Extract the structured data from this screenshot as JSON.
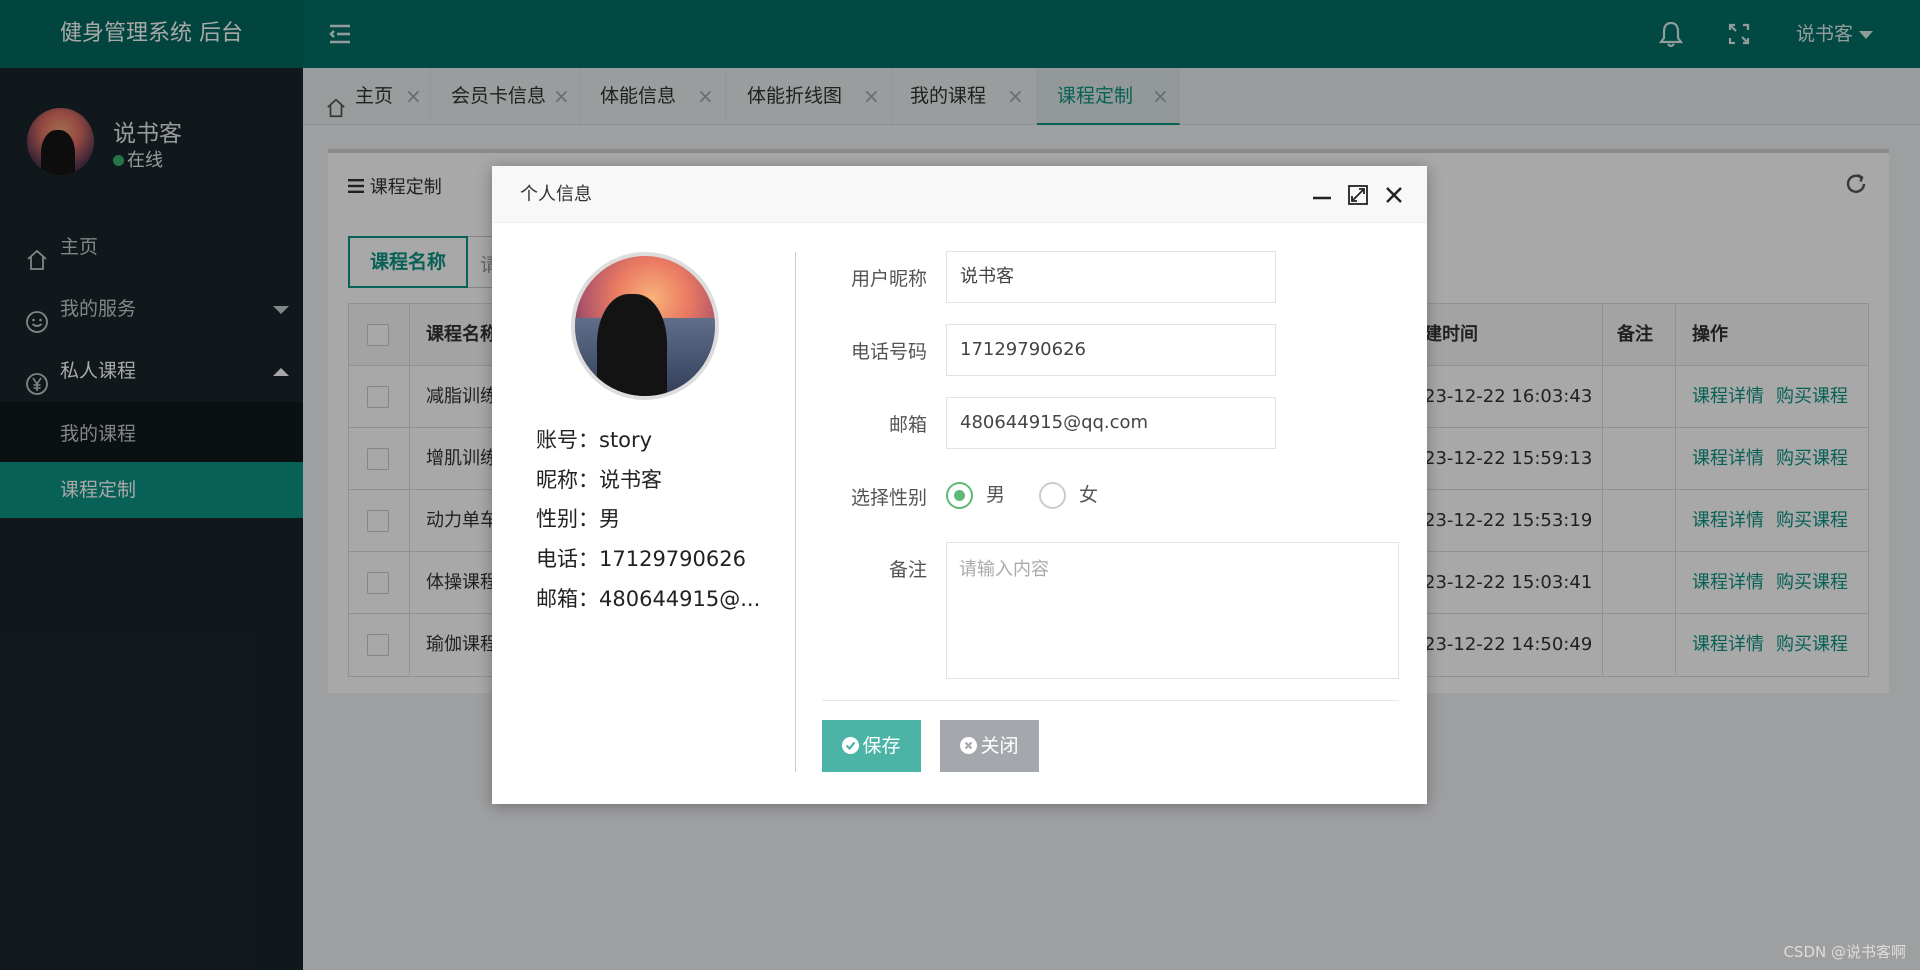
{
  "header": {
    "logo": "健身管理系统 后台",
    "user": "说书客",
    "icons": [
      "menu-toggle-icon",
      "bell-icon",
      "fullscreen-icon"
    ]
  },
  "sidebar": {
    "user": {
      "name": "说书客",
      "status": "在线"
    },
    "items": [
      {
        "label": "主页",
        "icon": "home-icon"
      },
      {
        "label": "我的服务",
        "icon": "smile-icon"
      },
      {
        "label": "私人课程",
        "icon": "yen-icon"
      }
    ],
    "sub_items": [
      {
        "label": "我的课程",
        "active": false
      },
      {
        "label": "课程定制",
        "active": true
      }
    ]
  },
  "tabs": [
    {
      "label": "主页",
      "active": false
    },
    {
      "label": "会员卡信息",
      "active": false
    },
    {
      "label": "体能信息",
      "active": false
    },
    {
      "label": "体能折线图",
      "active": false
    },
    {
      "label": "我的课程",
      "active": false
    },
    {
      "label": "课程定制",
      "active": true
    }
  ],
  "panel": {
    "title": "课程定制",
    "search_tab": "课程名称",
    "search_tab2": "请",
    "columns": {
      "name": "课程名称",
      "time": "建时间",
      "remark": "备注",
      "ops": "操作"
    },
    "rows": [
      {
        "name": "减脂训练",
        "time": "23-12-22 16:03:43"
      },
      {
        "name": "增肌训练",
        "time": "23-12-22 15:59:13"
      },
      {
        "name": "动力单车",
        "time": "23-12-22 15:53:19"
      },
      {
        "name": "体操课程",
        "time": "23-12-22 15:03:41"
      },
      {
        "name": "瑜伽课程",
        "time": "23-12-22 14:50:49"
      }
    ],
    "op_detail": "课程详情",
    "op_buy": "购买课程"
  },
  "modal": {
    "title": "个人信息",
    "info": {
      "account": "账号：story",
      "nickname": "昵称：说书客",
      "gender": "性别：男",
      "phone": "电话：17129790626",
      "email": "邮箱：480644915@..."
    },
    "form": {
      "nickname_label": "用户昵称",
      "nickname_value": "说书客",
      "phone_label": "电话号码",
      "phone_value": "17129790626",
      "email_label": "邮箱",
      "email_value": "480644915@qq.com",
      "gender_label": "选择性别",
      "gender_male": "男",
      "gender_female": "女",
      "gender_selected": "男",
      "remark_label": "备注",
      "remark_placeholder": "请输入内容"
    },
    "buttons": {
      "save": "保存",
      "close": "关闭"
    }
  },
  "watermark": "CSDN @说书客啊",
  "colors": {
    "primary": "#026f65",
    "accent": "#0d9485",
    "save": "#4cb4a6",
    "close": "#a4a8ac"
  }
}
